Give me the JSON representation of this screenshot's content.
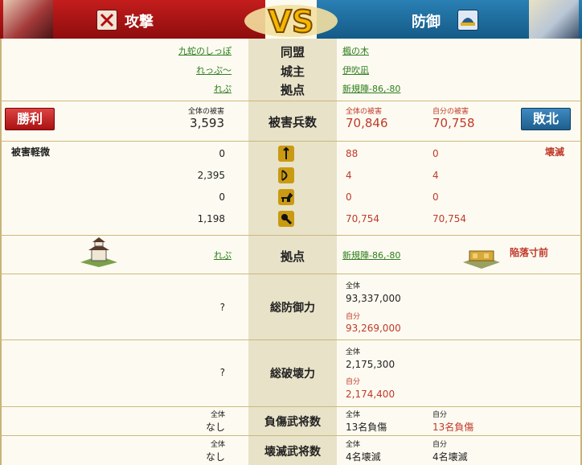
{
  "header": {
    "attack_title": "攻撃",
    "defense_title": "防御",
    "vs": "VS"
  },
  "rows": {
    "alliance": {
      "label": "同盟",
      "attacker": "九蛇のしっぽ",
      "defender": "楓の木"
    },
    "lord": {
      "label": "城主",
      "attacker": "れっぷ〜",
      "defender": "伊吹凪"
    },
    "base": {
      "label": "拠点",
      "attacker": "れぷ",
      "defender": "新規陣-86,-80"
    }
  },
  "damage": {
    "label": "被害兵数",
    "result_attacker": "勝利",
    "result_defender": "敗北",
    "att_total_label": "全体の被害",
    "att_total": "3,593",
    "def_total_label": "全体の被害",
    "def_total": "70,846",
    "def_self_label": "自分の被害",
    "def_self": "70,758"
  },
  "units": {
    "att_status": "被害軽微",
    "def_status": "壊滅",
    "rows": [
      {
        "icon": "spear-icon",
        "att": "0",
        "def_total": "88",
        "def_self": "0"
      },
      {
        "icon": "bow-icon",
        "att": "2,395",
        "def_total": "4",
        "def_self": "4"
      },
      {
        "icon": "horse-icon",
        "att": "0",
        "def_total": "0",
        "def_self": "0"
      },
      {
        "icon": "siege-icon",
        "att": "1,198",
        "def_total": "70,754",
        "def_self": "70,754"
      }
    ]
  },
  "base2": {
    "label": "拠点",
    "attacker": "れぷ",
    "defender": "新規陣-86,-80",
    "defender_status": "陥落寸前"
  },
  "defense_power": {
    "label": "総防御力",
    "attacker": "?",
    "total_label": "全体",
    "total": "93,337,000",
    "self_label": "自分",
    "self": "93,269,000"
  },
  "destruction_power": {
    "label": "総破壊力",
    "attacker": "?",
    "total_label": "全体",
    "total": "2,175,300",
    "self_label": "自分",
    "self": "2,174,400"
  },
  "injured": {
    "label": "負傷武将数",
    "att_label": "全体",
    "att": "なし",
    "def_total_label": "全体",
    "def_total": "13名負傷",
    "def_self_label": "自分",
    "def_self": "13名負傷"
  },
  "destroyed": {
    "label": "壊滅武将数",
    "att_label": "全体",
    "att": "なし",
    "def_total_label": "全体",
    "def_total": "4名壊滅",
    "def_self_label": "自分",
    "def_self": "4名壊滅"
  }
}
